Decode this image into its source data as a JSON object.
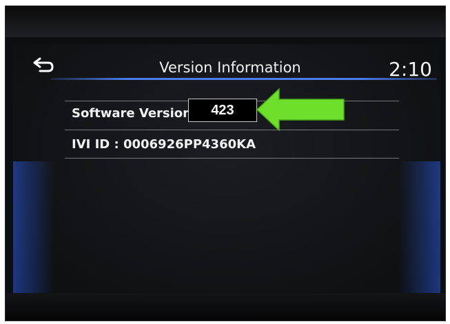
{
  "header": {
    "title": "Version Information",
    "clock": "2:10"
  },
  "info": {
    "software_version_label": "Software Version",
    "ivi_id": "IVI ID : 0006926PP4360KA"
  },
  "callout": {
    "value": "423",
    "arrow_color": "#6ee02c"
  },
  "colors": {
    "accent_blue": "#4a7ef0",
    "screen_bg": "#111214"
  }
}
